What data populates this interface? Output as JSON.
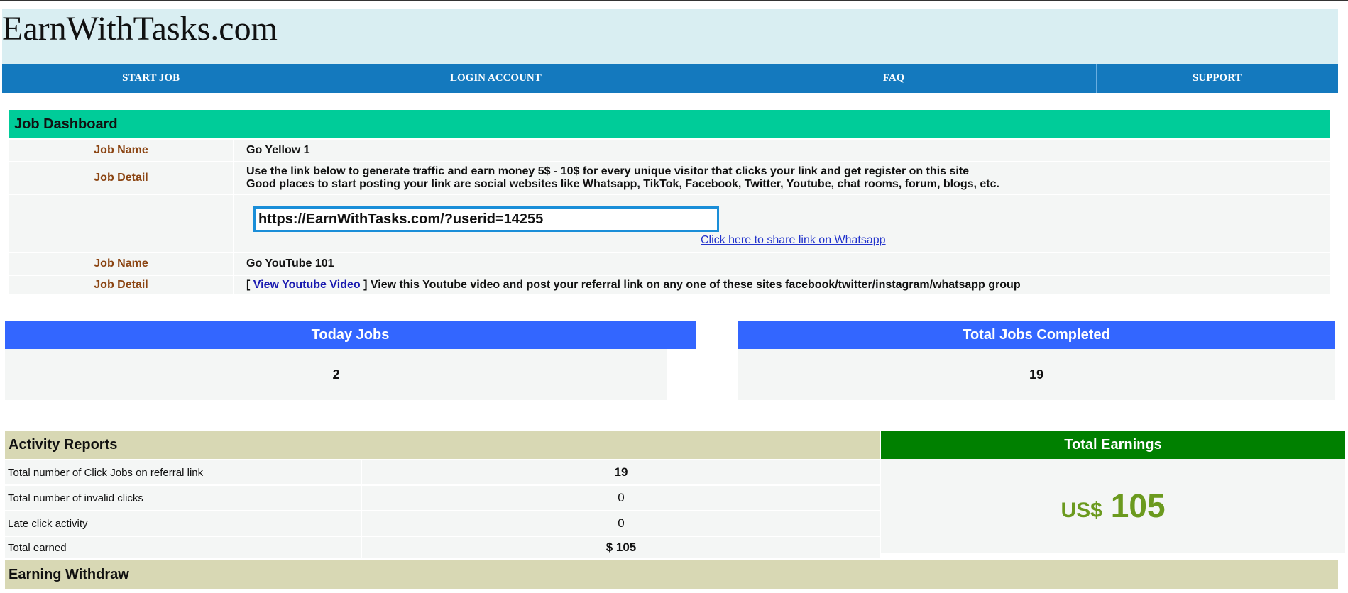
{
  "site": {
    "title": "EarnWithTasks.com"
  },
  "nav": {
    "items": [
      {
        "label": "START JOB"
      },
      {
        "label": "LOGIN ACCOUNT"
      },
      {
        "label": "FAQ"
      },
      {
        "label": "SUPPORT"
      }
    ]
  },
  "job_dashboard": {
    "title": "Job Dashboard",
    "job_name_label": "Job Name",
    "job_detail_label": "Job Detail",
    "job1": {
      "name": "Go Yellow 1",
      "detail_line1": "Use the link below to generate traffic and earn money 5$ - 10$ for every unique visitor that clicks your link and get register on this site",
      "detail_line2": "Good places to start posting your link are social websites like Whatsapp, TikTok, Facebook, Twitter, Youtube, chat rooms, forum, blogs, etc.",
      "referral_link": "https://EarnWithTasks.com/?userid=14255",
      "whatsapp_link": "Click here to share link on Whatsapp"
    },
    "job2": {
      "name": "Go YouTube 101",
      "detail_prefix": "[ ",
      "video_link": "View Youtube Video",
      "detail_suffix": " ] View this Youtube video and post your referral link on any one of these sites facebook/twitter/instagram/whatsapp group"
    }
  },
  "stats": {
    "today_jobs": {
      "label": "Today Jobs",
      "value": "2"
    },
    "total_jobs_completed": {
      "label": "Total Jobs Completed",
      "value": "19"
    }
  },
  "activity_reports": {
    "title": "Activity Reports",
    "rows": [
      {
        "label": "Total number of Click Jobs on referral link",
        "value": "19"
      },
      {
        "label": "Total number of invalid clicks",
        "value": "0"
      },
      {
        "label": "Late click activity",
        "value": "0"
      },
      {
        "label": "Total earned",
        "value": "$ 105"
      }
    ]
  },
  "total_earnings": {
    "title": "Total Earnings",
    "currency": "US$",
    "amount": "105"
  },
  "earning_withdraw": {
    "title": "Earning Withdraw"
  },
  "colors": {
    "header_bg": "#d9eef2",
    "nav_bg": "#1479be",
    "dashboard_header": "#00cc99",
    "stat_header": "#3366ff",
    "earnings_header": "#008000",
    "report_header": "#d8d8b4",
    "label_brown": "#8b4513",
    "earnings_text": "#6b9a1e"
  }
}
